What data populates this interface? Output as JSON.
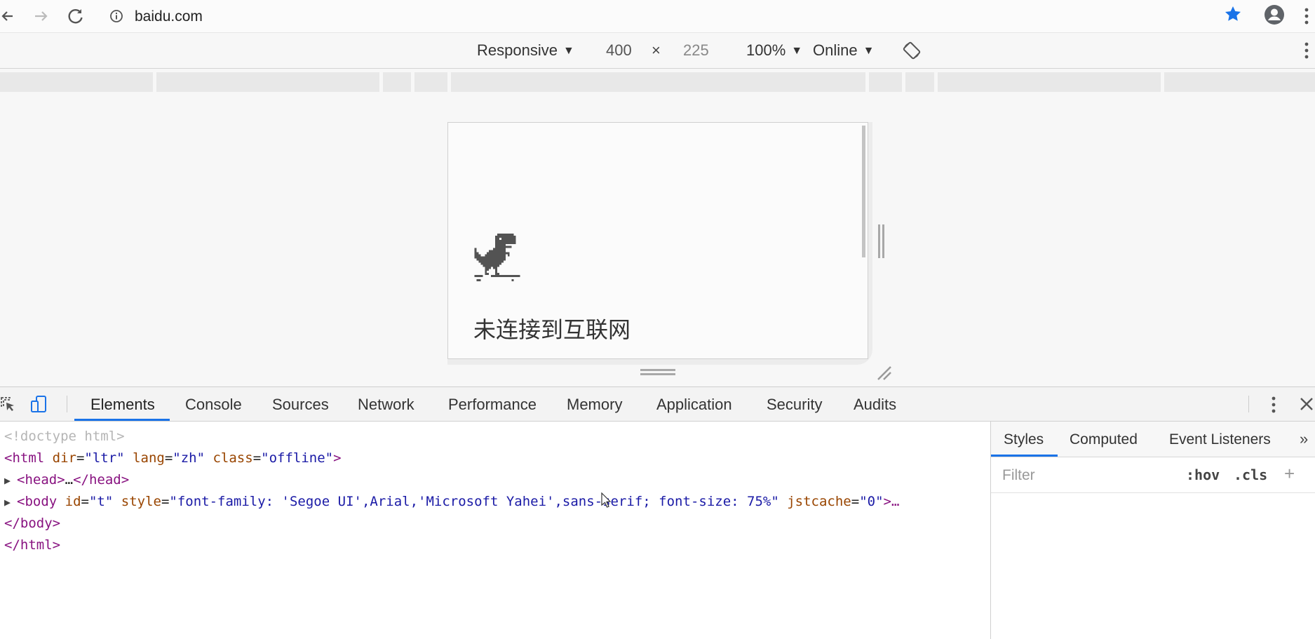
{
  "browser": {
    "url": "baidu.com",
    "icons": [
      "back-icon",
      "forward-icon",
      "reload-icon",
      "site-info-icon",
      "bookmark-star-icon",
      "account-icon",
      "chrome-menu-icon"
    ],
    "star_color": "#1a73e8"
  },
  "device_toolbar": {
    "device": "Responsive",
    "width": "400",
    "times": "×",
    "height": "225",
    "zoom": "100%",
    "throttle": "Online",
    "caret": "▼"
  },
  "viewport": {
    "offline_title": "未连接到互联网",
    "dino_icon": "dino-icon"
  },
  "devtools": {
    "tabs": [
      "Elements",
      "Console",
      "Sources",
      "Network",
      "Performance",
      "Memory",
      "Application",
      "Security",
      "Audits"
    ],
    "active_tab": "Elements",
    "accent": "#1a73e8",
    "code": {
      "doctype": "<!doctype html>",
      "html_open": {
        "tag": "<html",
        "a1": " dir",
        "v1": "\"ltr\"",
        "a2": " lang",
        "v2": "\"zh\"",
        "a3": " class",
        "v3": "\"offline\"",
        "end": ">"
      },
      "head": {
        "open": "<head>",
        "ellipsis": "…",
        "close": "</head>"
      },
      "body": {
        "tag": "<body",
        "a1": " id",
        "v1": "\"t\"",
        "a2": " style",
        "v2": "\"font-family: 'Segoe UI',Arial,'Microsoft Yahei',sans-serif; font-size: 75%\"",
        "a3": " jstcache",
        "v3": "\"0\"",
        "end": ">…"
      },
      "body_close": "</body>",
      "html_close": "</html>",
      "eq": "="
    },
    "styles": {
      "tabs": [
        "Styles",
        "Computed",
        "Event Listeners"
      ],
      "more": "»",
      "filter_placeholder": "Filter",
      "hov": ":hov",
      "cls": ".cls",
      "plus": "+"
    }
  }
}
